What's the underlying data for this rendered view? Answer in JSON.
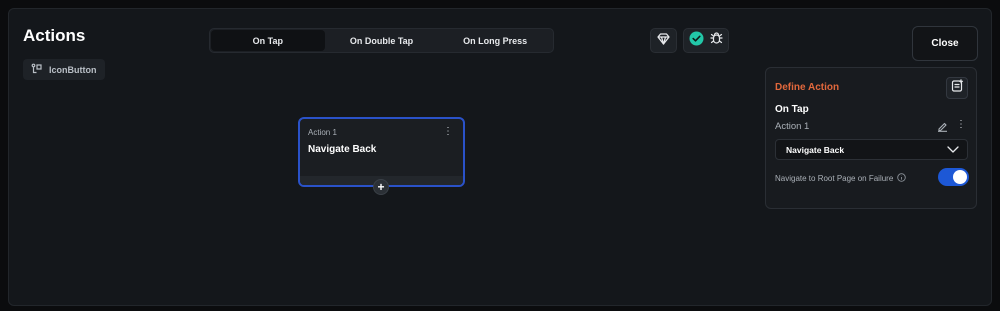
{
  "header": {
    "title": "Actions",
    "widget_chip": "IconButton",
    "close_label": "Close"
  },
  "tabs": [
    {
      "label": "On Tap",
      "active": true
    },
    {
      "label": "On Double Tap",
      "active": false
    },
    {
      "label": "On Long Press",
      "active": false
    }
  ],
  "toolbar_icons": [
    "gem-icon",
    "check-circle-icon",
    "bug-icon"
  ],
  "canvas": {
    "card": {
      "subtitle": "Action 1",
      "title": "Navigate Back"
    },
    "add_symbol": "+"
  },
  "define_panel": {
    "title": "Define Action",
    "trigger": "On Tap",
    "action_name": "Action 1",
    "selected_action": "Navigate Back",
    "toggle_label": "Navigate to Root Page on Failure",
    "toggle_on": true
  },
  "colors": {
    "accent_orange": "#e2683c",
    "selection_blue": "#2a52c9",
    "toggle_blue": "#1d58d6",
    "check_teal": "#22c7a8"
  }
}
